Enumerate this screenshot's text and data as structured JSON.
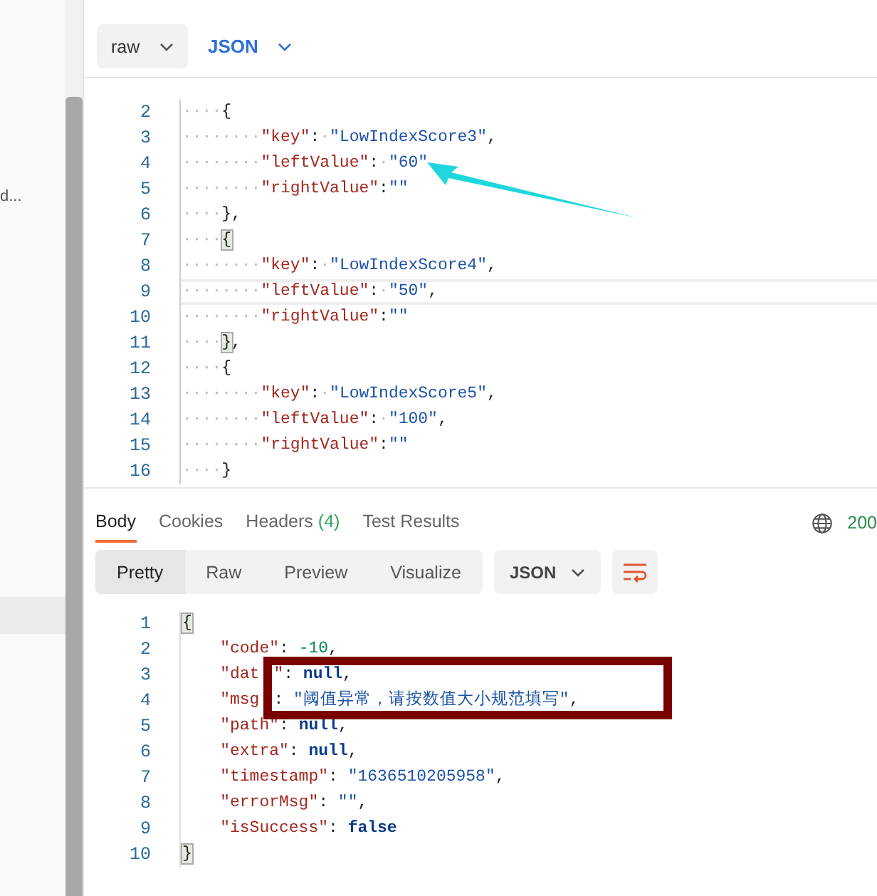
{
  "sidebar": {
    "items": [
      {
        "label": "d...",
        "selected": false
      },
      {
        "selected": true
      }
    ]
  },
  "request": {
    "body_mode": "raw",
    "language": "JSON",
    "lines": [
      {
        "number": "2",
        "current": false,
        "segments": [
          {
            "kind": "ws",
            "text": "····"
          },
          {
            "kind": "brace",
            "text": "{",
            "bracket_match": false
          }
        ]
      },
      {
        "number": "3",
        "current": false,
        "segments": [
          {
            "kind": "ws",
            "text": "········"
          },
          {
            "kind": "key",
            "text": "\"key\""
          },
          {
            "kind": "punct",
            "text": ":"
          },
          {
            "kind": "ws",
            "text": "·"
          },
          {
            "kind": "str",
            "text": "\"LowIndexScore3\""
          },
          {
            "kind": "punct",
            "text": ","
          }
        ]
      },
      {
        "number": "4",
        "current": false,
        "segments": [
          {
            "kind": "ws",
            "text": "········"
          },
          {
            "kind": "key",
            "text": "\"leftValue\""
          },
          {
            "kind": "punct",
            "text": ":"
          },
          {
            "kind": "ws",
            "text": "·"
          },
          {
            "kind": "str",
            "text": "\"60\""
          }
        ]
      },
      {
        "number": "5",
        "current": false,
        "segments": [
          {
            "kind": "ws",
            "text": "········"
          },
          {
            "kind": "key",
            "text": "\"rightValue\""
          },
          {
            "kind": "punct",
            "text": ":"
          },
          {
            "kind": "str",
            "text": "\"\""
          }
        ]
      },
      {
        "number": "6",
        "current": false,
        "segments": [
          {
            "kind": "ws",
            "text": "····"
          },
          {
            "kind": "brace",
            "text": "}",
            "bracket_match": false
          },
          {
            "kind": "punct",
            "text": ","
          }
        ]
      },
      {
        "number": "7",
        "current": false,
        "segments": [
          {
            "kind": "ws",
            "text": "····"
          },
          {
            "kind": "brace",
            "text": "{",
            "bracket_match": true
          }
        ]
      },
      {
        "number": "8",
        "current": false,
        "segments": [
          {
            "kind": "ws",
            "text": "········"
          },
          {
            "kind": "key",
            "text": "\"key\""
          },
          {
            "kind": "punct",
            "text": ":"
          },
          {
            "kind": "ws",
            "text": "·"
          },
          {
            "kind": "str",
            "text": "\"LowIndexScore4\""
          },
          {
            "kind": "punct",
            "text": ","
          }
        ]
      },
      {
        "number": "9",
        "current": true,
        "segments": [
          {
            "kind": "ws",
            "text": "········"
          },
          {
            "kind": "key",
            "text": "\"leftValue\""
          },
          {
            "kind": "punct",
            "text": ":"
          },
          {
            "kind": "ws",
            "text": "·"
          },
          {
            "kind": "str",
            "text": "\"50\""
          },
          {
            "kind": "punct",
            "text": ","
          }
        ]
      },
      {
        "number": "10",
        "current": false,
        "segments": [
          {
            "kind": "ws",
            "text": "········"
          },
          {
            "kind": "key",
            "text": "\"rightValue\""
          },
          {
            "kind": "punct",
            "text": ":"
          },
          {
            "kind": "str",
            "text": "\"\""
          }
        ]
      },
      {
        "number": "11",
        "current": false,
        "segments": [
          {
            "kind": "ws",
            "text": "····"
          },
          {
            "kind": "brace",
            "text": "}",
            "bracket_match": true
          },
          {
            "kind": "punct",
            "text": ","
          }
        ]
      },
      {
        "number": "12",
        "current": false,
        "segments": [
          {
            "kind": "ws",
            "text": "····"
          },
          {
            "kind": "brace",
            "text": "{",
            "bracket_match": false
          }
        ]
      },
      {
        "number": "13",
        "current": false,
        "segments": [
          {
            "kind": "ws",
            "text": "········"
          },
          {
            "kind": "key",
            "text": "\"key\""
          },
          {
            "kind": "punct",
            "text": ":"
          },
          {
            "kind": "ws",
            "text": "·"
          },
          {
            "kind": "str",
            "text": "\"LowIndexScore5\""
          },
          {
            "kind": "punct",
            "text": ","
          }
        ]
      },
      {
        "number": "14",
        "current": false,
        "segments": [
          {
            "kind": "ws",
            "text": "········"
          },
          {
            "kind": "key",
            "text": "\"leftValue\""
          },
          {
            "kind": "punct",
            "text": ":"
          },
          {
            "kind": "ws",
            "text": "·"
          },
          {
            "kind": "str",
            "text": "\"100\""
          },
          {
            "kind": "punct",
            "text": ","
          }
        ]
      },
      {
        "number": "15",
        "current": false,
        "segments": [
          {
            "kind": "ws",
            "text": "········"
          },
          {
            "kind": "key",
            "text": "\"rightValue\""
          },
          {
            "kind": "punct",
            "text": ":"
          },
          {
            "kind": "str",
            "text": "\"\""
          }
        ]
      },
      {
        "number": "16",
        "current": false,
        "segments": [
          {
            "kind": "ws",
            "text": "····"
          },
          {
            "kind": "brace",
            "text": "}",
            "bracket_match": false
          }
        ]
      }
    ]
  },
  "response": {
    "tabs": [
      {
        "label": "Body",
        "selected": true
      },
      {
        "label": "Cookies",
        "selected": false
      },
      {
        "label": "Headers",
        "count": "(4)",
        "selected": false
      },
      {
        "label": "Test Results",
        "selected": false
      }
    ],
    "status": "200",
    "views": [
      {
        "label": "Pretty",
        "selected": true
      },
      {
        "label": "Raw",
        "selected": false
      },
      {
        "label": "Preview",
        "selected": false
      },
      {
        "label": "Visualize",
        "selected": false
      }
    ],
    "format": "JSON",
    "lines": [
      {
        "number": "1",
        "current": false,
        "segments": [
          {
            "kind": "brace",
            "text": "{",
            "bracket_match": true
          }
        ]
      },
      {
        "number": "2",
        "current": false,
        "segments": [
          {
            "kind": "key",
            "text": "\"code\""
          },
          {
            "kind": "punct",
            "text": ": "
          },
          {
            "kind": "num",
            "text": "-10"
          },
          {
            "kind": "punct",
            "text": ","
          }
        ]
      },
      {
        "number": "3",
        "current": false,
        "segments": [
          {
            "kind": "key",
            "text": "\"dat"
          },
          {
            "kind": "gap"
          },
          {
            "kind": "key",
            "text": "\""
          },
          {
            "kind": "punct",
            "text": ": "
          },
          {
            "kind": "kw",
            "text": "null"
          },
          {
            "kind": "punct",
            "text": ","
          }
        ]
      },
      {
        "number": "4",
        "current": false,
        "segments": [
          {
            "kind": "key",
            "text": "\"msg"
          },
          {
            "kind": "gap"
          },
          {
            "kind": "punct",
            "text": ": "
          },
          {
            "kind": "str",
            "text": "\"阈值异常，请按数值大小规范填写\""
          },
          {
            "kind": "punct",
            "text": ","
          }
        ]
      },
      {
        "number": "5",
        "current": false,
        "segments": [
          {
            "kind": "key",
            "text": "\"path\""
          },
          {
            "kind": "punct",
            "text": ": "
          },
          {
            "kind": "kw",
            "text": "null"
          },
          {
            "kind": "punct",
            "text": ","
          }
        ]
      },
      {
        "number": "6",
        "current": false,
        "segments": [
          {
            "kind": "key",
            "text": "\"extra\""
          },
          {
            "kind": "punct",
            "text": ": "
          },
          {
            "kind": "kw",
            "text": "null"
          },
          {
            "kind": "punct",
            "text": ","
          }
        ]
      },
      {
        "number": "7",
        "current": false,
        "segments": [
          {
            "kind": "key",
            "text": "\"timestamp\""
          },
          {
            "kind": "punct",
            "text": ": "
          },
          {
            "kind": "str",
            "text": "\"1636510205958\""
          },
          {
            "kind": "punct",
            "text": ","
          }
        ]
      },
      {
        "number": "8",
        "current": false,
        "segments": [
          {
            "kind": "key",
            "text": "\"errorMsg\""
          },
          {
            "kind": "punct",
            "text": ": "
          },
          {
            "kind": "str",
            "text": "\"\""
          },
          {
            "kind": "punct",
            "text": ","
          }
        ]
      },
      {
        "number": "9",
        "current": false,
        "segments": [
          {
            "kind": "key",
            "text": "\"isSuccess\""
          },
          {
            "kind": "punct",
            "text": ": "
          },
          {
            "kind": "kw",
            "text": "false"
          }
        ]
      },
      {
        "number": "10",
        "current": false,
        "segments": [
          {
            "kind": "brace",
            "text": "}",
            "bracket_match": true
          }
        ]
      }
    ]
  }
}
